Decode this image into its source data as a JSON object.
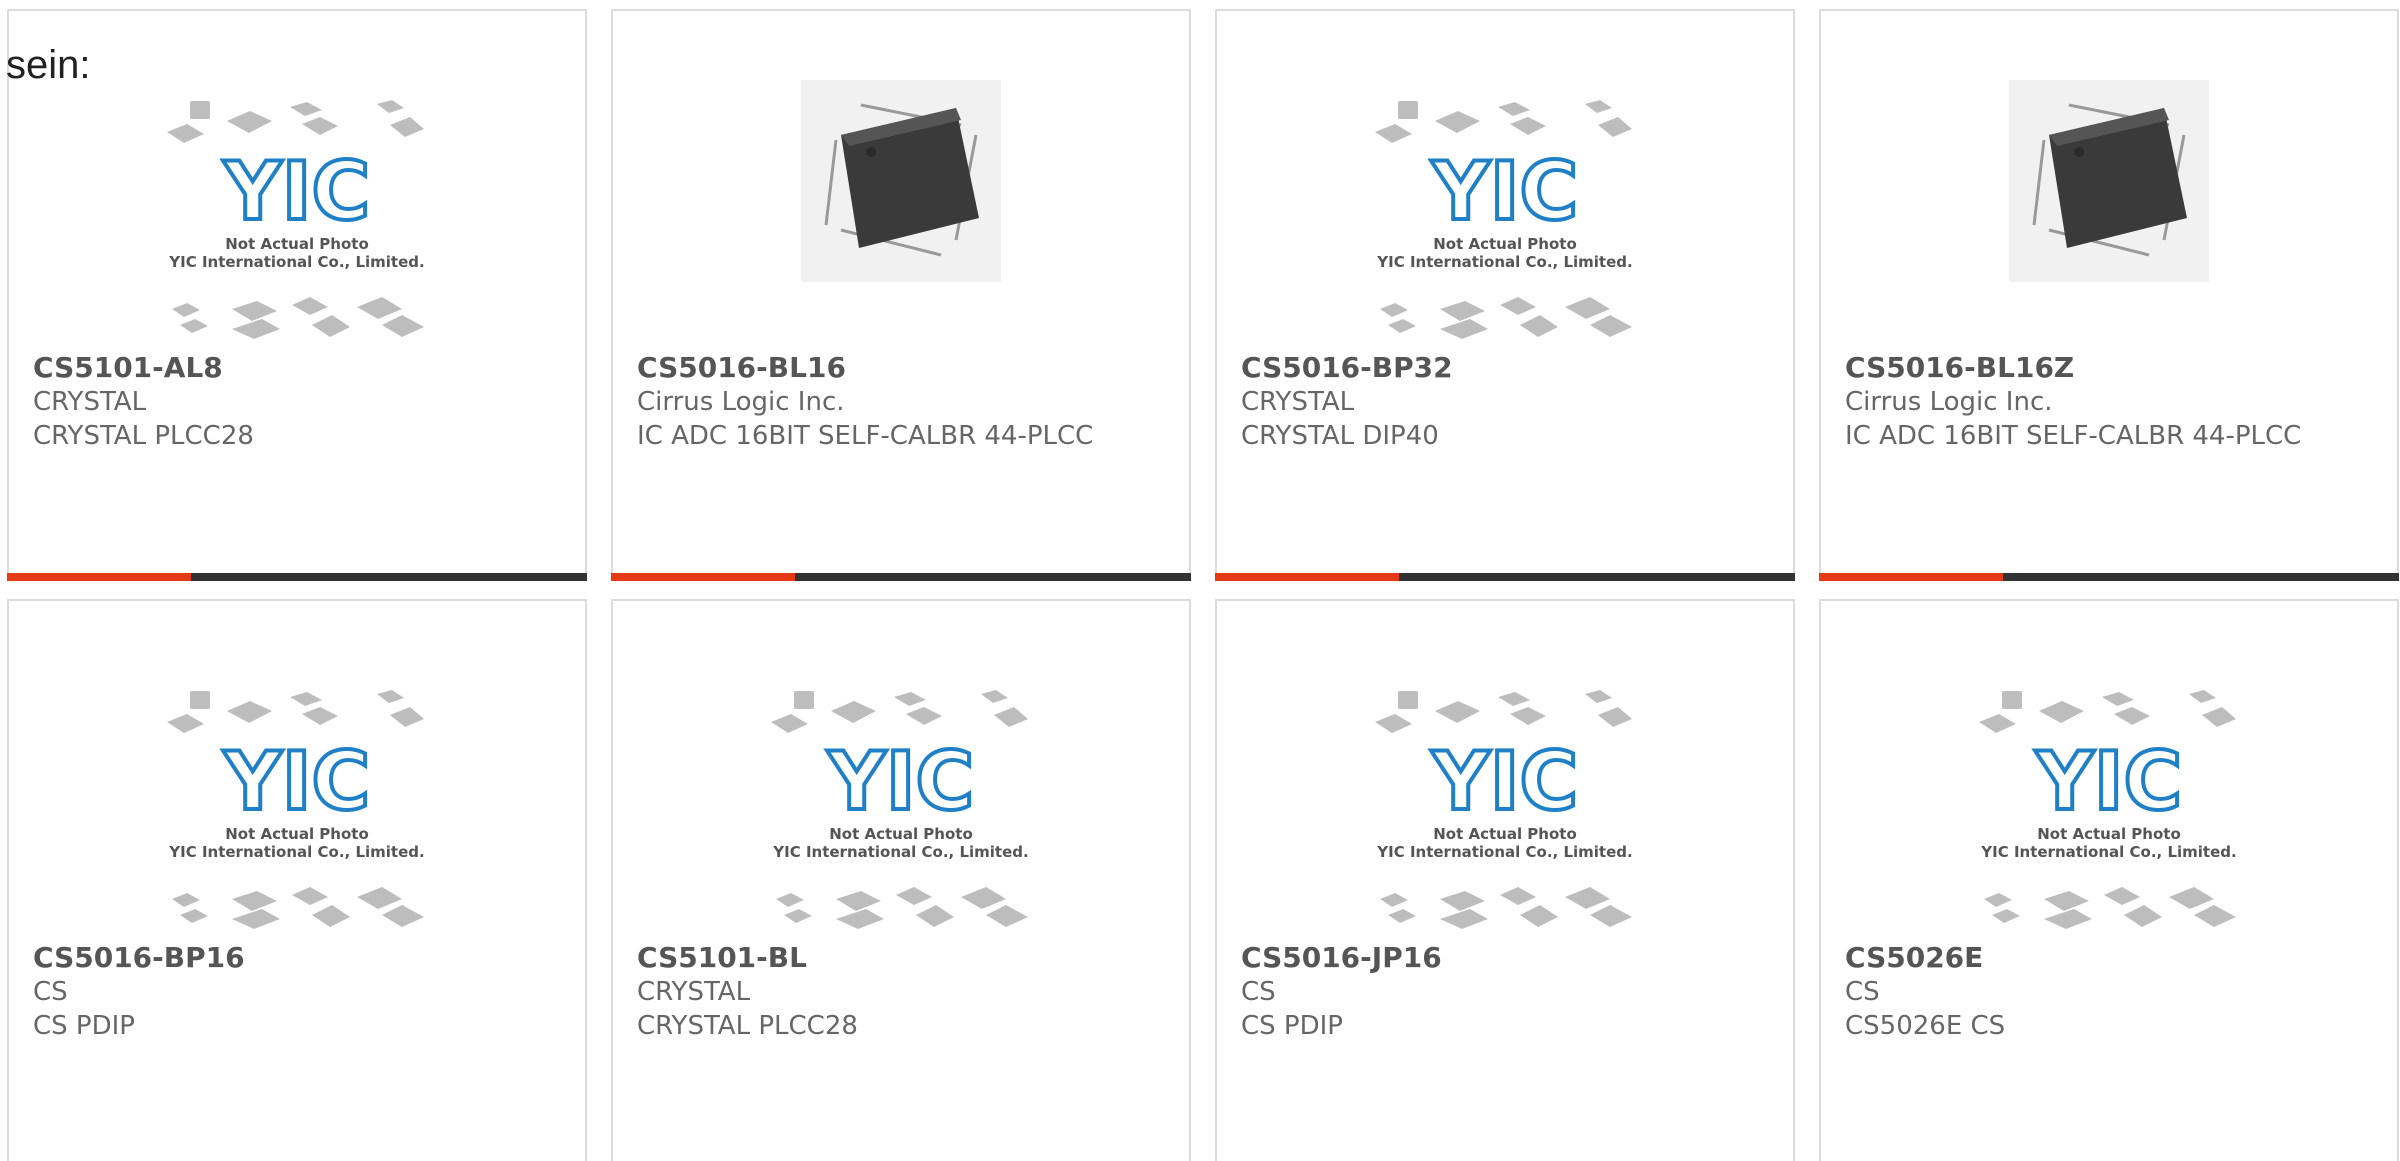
{
  "stray_text": "sein:",
  "placeholder": {
    "caption_line1": "Not Actual Photo",
    "caption_line2": "YIC International Co., Limited.",
    "logo_text": "YIC"
  },
  "colors": {
    "accent": "#e53a16",
    "bar_dark": "#333333",
    "logo_blue": "#1f7fc7",
    "text_gray": "#666666"
  },
  "products": [
    {
      "part": "CS5101-AL8",
      "maker": "CRYSTAL",
      "desc": "CRYSTAL PLCC28",
      "image": "placeholder"
    },
    {
      "part": "CS5016-BL16",
      "maker": "Cirrus Logic Inc.",
      "desc": "IC ADC 16BIT SELF-CALBR 44-PLCC",
      "image": "chip-photo"
    },
    {
      "part": "CS5016-BP32",
      "maker": "CRYSTAL",
      "desc": "CRYSTAL DIP40",
      "image": "placeholder"
    },
    {
      "part": "CS5016-BL16Z",
      "maker": "Cirrus Logic Inc.",
      "desc": "IC ADC 16BIT SELF-CALBR 44-PLCC",
      "image": "chip-photo"
    },
    {
      "part": "CS5016-BP16",
      "maker": "CS",
      "desc": "CS PDIP",
      "image": "placeholder"
    },
    {
      "part": "CS5101-BL",
      "maker": "CRYSTAL",
      "desc": "CRYSTAL PLCC28",
      "image": "placeholder"
    },
    {
      "part": "CS5016-JP16",
      "maker": "CS",
      "desc": "CS PDIP",
      "image": "placeholder"
    },
    {
      "part": "CS5026E",
      "maker": "CS",
      "desc": "CS5026E CS",
      "image": "placeholder"
    }
  ]
}
